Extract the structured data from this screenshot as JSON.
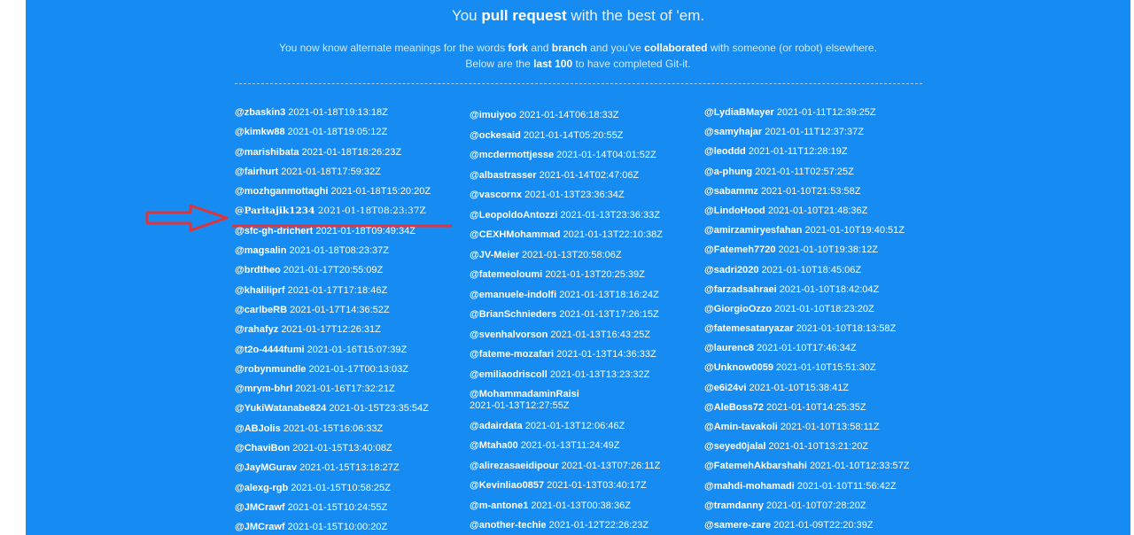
{
  "heading": {
    "pre": "You ",
    "bold": "pull request",
    "post": " with the best of 'em."
  },
  "paragraph1": {
    "t1": "You now know alternate meanings for the words ",
    "b1": "fork",
    "t2": " and ",
    "b2": "branch",
    "t3": " and you've ",
    "b3": "collaborated",
    "t4": " with someone (or robot) elsewhere."
  },
  "paragraph2": {
    "t1": "Below are the ",
    "b1": "last 100",
    "t2": " to have completed Git-it."
  },
  "colors": {
    "background": "#168cf2",
    "text": "#ffffff",
    "annotation": "#e0333a"
  },
  "columns": [
    [
      {
        "user": "@zbaskin3",
        "ts": "2021-01-18T19:13:18Z"
      },
      {
        "user": "@kimkw88",
        "ts": "2021-01-18T19:05:12Z"
      },
      {
        "user": "@marishibata",
        "ts": "2021-01-18T18:26:23Z"
      },
      {
        "user": "@fairhurt",
        "ts": "2021-01-18T17:59:32Z"
      },
      {
        "user": "@mozhganmottaghi",
        "ts": "2021-01-18T15:20:20Z"
      },
      {
        "user": "@Paritajik1234",
        "ts": "2021-01-18T08:23:37Z"
      },
      {
        "user": "@sfc-gh-drichert",
        "ts": "2021-01-18T09:49:34Z"
      },
      {
        "user": "@magsalin",
        "ts": "2021-01-18T08:23:37Z"
      },
      {
        "user": "@brdtheo",
        "ts": "2021-01-17T20:55:09Z"
      },
      {
        "user": "@khaliliprf",
        "ts": "2021-01-17T17:18:46Z"
      },
      {
        "user": "@carlbeRB",
        "ts": "2021-01-17T14:36:52Z"
      },
      {
        "user": "@rahafyz",
        "ts": "2021-01-17T12:26:31Z"
      },
      {
        "user": "@t2o-4444fumi",
        "ts": "2021-01-16T15:07:39Z"
      },
      {
        "user": "@robynmundle",
        "ts": "2021-01-17T00:13:03Z"
      },
      {
        "user": "@mrym-bhrl",
        "ts": "2021-01-16T17:32:21Z"
      },
      {
        "user": "@YukiWatanabe824",
        "ts": "2021-01-15T23:35:54Z"
      },
      {
        "user": "@ABJolis",
        "ts": "2021-01-15T16:06:33Z"
      },
      {
        "user": "@ChaviBon",
        "ts": "2021-01-15T13:40:08Z"
      },
      {
        "user": "@JayMGurav",
        "ts": "2021-01-15T13:18:27Z"
      },
      {
        "user": "@alexg-rgb",
        "ts": "2021-01-15T10:58:25Z"
      },
      {
        "user": "@JMCrawf",
        "ts": "2021-01-15T10:24:55Z"
      },
      {
        "user": "@JMCrawf",
        "ts": "2021-01-15T10:00:20Z"
      }
    ],
    [
      {
        "user": "@imuiyoo",
        "ts": "2021-01-14T06:18:33Z"
      },
      {
        "user": "@ockesaid",
        "ts": "2021-01-14T05:20:55Z"
      },
      {
        "user": "@mcdermottjesse",
        "ts": "2021-01-14T04:01:52Z"
      },
      {
        "user": "@albastrasser",
        "ts": "2021-01-14T02:47:06Z"
      },
      {
        "user": "@vascornx",
        "ts": "2021-01-13T23:36:34Z"
      },
      {
        "user": "@LeopoldoAntozzi",
        "ts": "2021-01-13T23:36:33Z"
      },
      {
        "user": "@CEXHMohammad",
        "ts": "2021-01-13T22:10:38Z"
      },
      {
        "user": "@JV-Meier",
        "ts": "2021-01-13T20:58:06Z"
      },
      {
        "user": "@fatemeoloumi",
        "ts": "2021-01-13T20:25:39Z"
      },
      {
        "user": "@emanuele-indolfi",
        "ts": "2021-01-13T18:16:24Z"
      },
      {
        "user": "@BrianSchnieders",
        "ts": "2021-01-13T17:26:15Z"
      },
      {
        "user": "@svenhalvorson",
        "ts": "2021-01-13T16:43:25Z"
      },
      {
        "user": "@fateme-mozafari",
        "ts": "2021-01-13T14:36:33Z"
      },
      {
        "user": "@emiliaodriscoll",
        "ts": "2021-01-13T13:23:32Z"
      },
      {
        "user": "@MohammadaminRaisi",
        "ts": "2021-01-13T12:27:55Z"
      },
      {
        "user": "@adairdata",
        "ts": "2021-01-13T12:06:46Z"
      },
      {
        "user": "@Mtaha00",
        "ts": "2021-01-13T11:24:49Z"
      },
      {
        "user": "@alirezasaeidipour",
        "ts": "2021-01-13T07:26:11Z"
      },
      {
        "user": "@Kevinliao0857",
        "ts": "2021-01-13T03:40:17Z"
      },
      {
        "user": "@m-antone1",
        "ts": "2021-01-13T00:38:36Z"
      },
      {
        "user": "@another-techie",
        "ts": "2021-01-12T22:26:23Z"
      }
    ],
    [
      {
        "user": "@LydiaBMayer",
        "ts": "2021-01-11T12:39:25Z"
      },
      {
        "user": "@samyhajar",
        "ts": "2021-01-11T12:37:37Z"
      },
      {
        "user": "@leoddd",
        "ts": "2021-01-11T12:28:19Z"
      },
      {
        "user": "@a-phung",
        "ts": "2021-01-11T02:57:25Z"
      },
      {
        "user": "@sabammz",
        "ts": "2021-01-10T21:53:58Z"
      },
      {
        "user": "@LindoHood",
        "ts": "2021-01-10T21:48:36Z"
      },
      {
        "user": "@amirzamiryesfahan",
        "ts": "2021-01-10T19:40:51Z"
      },
      {
        "user": "@Fatemeh7720",
        "ts": "2021-01-10T19:38:12Z"
      },
      {
        "user": "@sadri2020",
        "ts": "2021-01-10T18:45:06Z"
      },
      {
        "user": "@farzadsahraei",
        "ts": "2021-01-10T18:42:04Z"
      },
      {
        "user": "@GiorgioOzzo",
        "ts": "2021-01-10T18:23:20Z"
      },
      {
        "user": "@fatemesataryazar",
        "ts": "2021-01-10T18:13:58Z"
      },
      {
        "user": "@laurenc8",
        "ts": "2021-01-10T17:46:34Z"
      },
      {
        "user": "@Unknow0059",
        "ts": "2021-01-10T15:51:30Z"
      },
      {
        "user": "@e6i24vi",
        "ts": "2021-01-10T15:38:41Z"
      },
      {
        "user": "@AleBoss72",
        "ts": "2021-01-10T14:25:35Z"
      },
      {
        "user": "@Amin-tavakoli",
        "ts": "2021-01-10T13:58:11Z"
      },
      {
        "user": "@seyed0jalal",
        "ts": "2021-01-10T13:21:20Z"
      },
      {
        "user": "@FatemehAkbarshahi",
        "ts": "2021-01-10T12:33:57Z"
      },
      {
        "user": "@mahdi-mohamadi",
        "ts": "2021-01-10T11:56:42Z"
      },
      {
        "user": "@tramdanny",
        "ts": "2021-01-10T07:28:20Z"
      },
      {
        "user": "@samere-zare",
        "ts": "2021-01-09T22:20:39Z"
      }
    ]
  ]
}
